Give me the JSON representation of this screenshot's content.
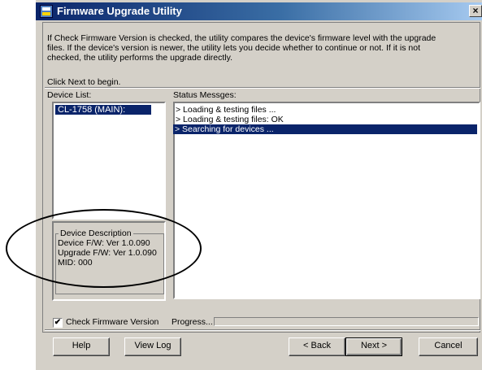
{
  "window": {
    "title": "Firmware Upgrade Utility",
    "close_label": "×"
  },
  "intro": {
    "text": "If Check Firmware Version is checked, the utility compares the device's firmware level with the upgrade\nfiles. If the device's version is newer, the utility lets you decide whether to continue or not. If it is not\nchecked, the utility performs the upgrade directly.",
    "click_next": "Click Next to begin."
  },
  "device_list": {
    "label": "Device List:",
    "items": [
      "CL-1758 (MAIN):"
    ]
  },
  "device_description": {
    "title": "Device Description",
    "lines": [
      "Device F/W: Ver 1.0.090",
      "Upgrade F/W: Ver 1.0.090",
      "MID: 000"
    ]
  },
  "status": {
    "label": "Status Messges:",
    "messages": [
      "> Loading & testing files ...",
      "> Loading & testing files: OK",
      "> Searching for devices ..."
    ],
    "selected_index": 2
  },
  "check_firmware": {
    "label": "Check Firmware Version",
    "checked": true,
    "mark": "✔"
  },
  "progress": {
    "label": "Progress...",
    "value": 0
  },
  "buttons": {
    "help": "Help",
    "view_log": "View Log",
    "back": "< Back",
    "next": "Next >",
    "cancel": "Cancel"
  },
  "colors": {
    "titlebar": "#0a246a",
    "selection": "#0a246a",
    "face": "#d4d0c8"
  }
}
